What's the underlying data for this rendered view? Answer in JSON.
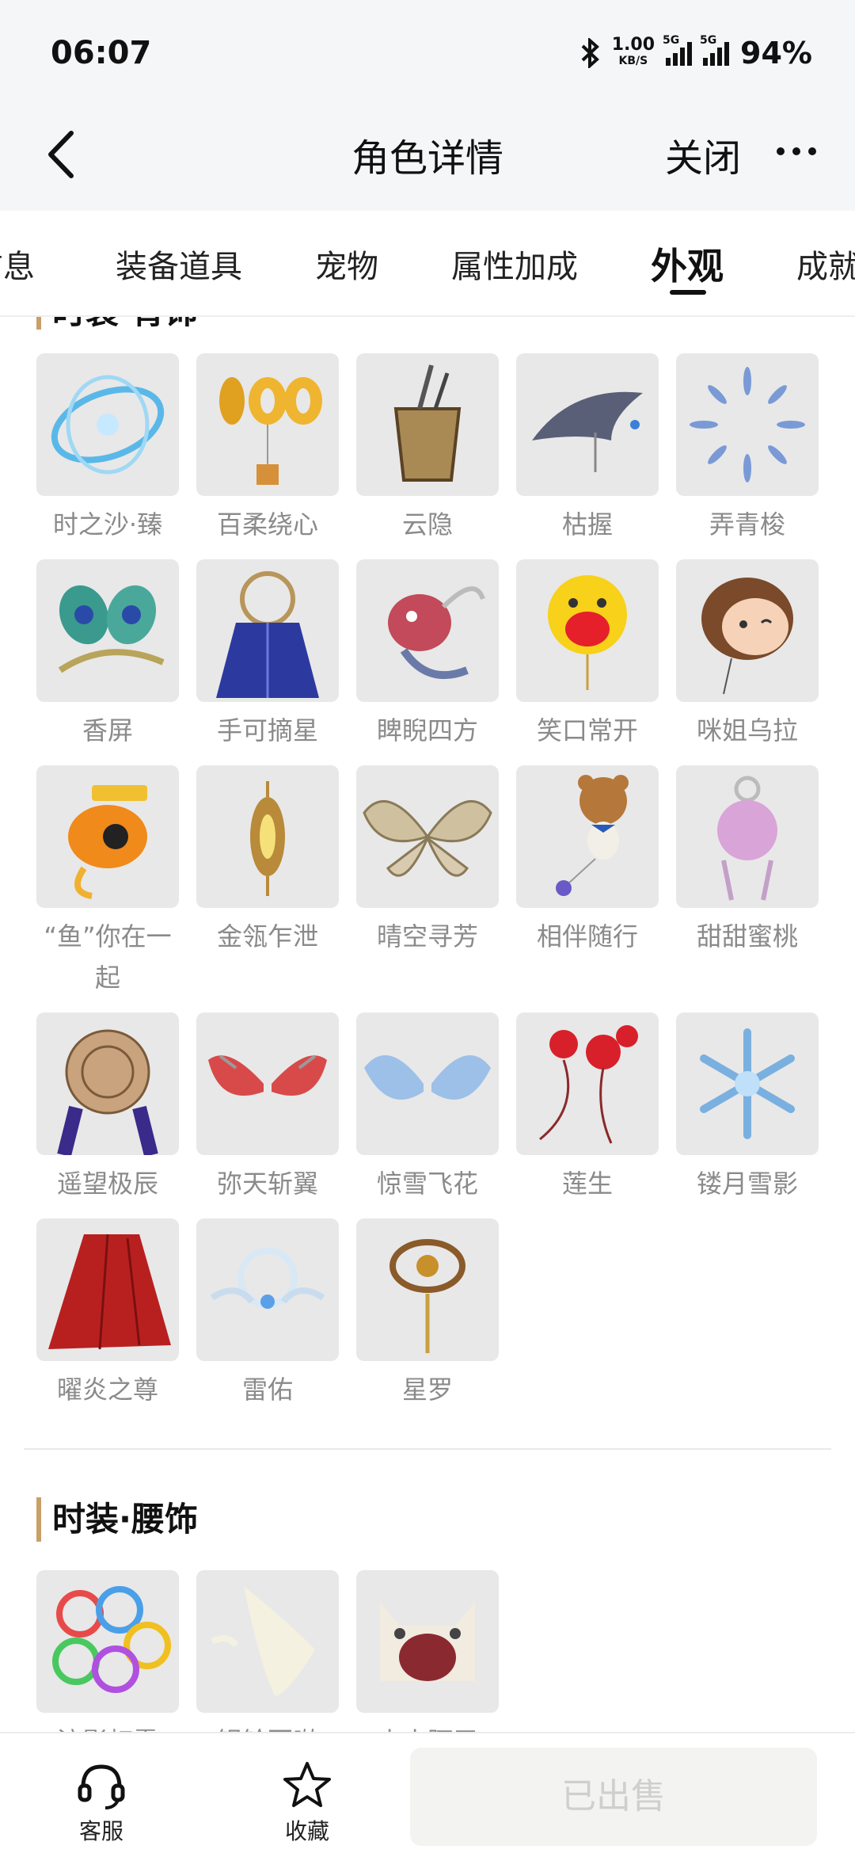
{
  "status": {
    "time": "06:07",
    "speed_value": "1.00",
    "speed_unit": "KB/S",
    "network": "5G",
    "battery": "94%"
  },
  "header": {
    "title": "角色详情",
    "close_label": "关闭"
  },
  "tabs": [
    {
      "label": "信息"
    },
    {
      "label": "装备道具"
    },
    {
      "label": "宠物"
    },
    {
      "label": "属性加成"
    },
    {
      "label": "外观"
    },
    {
      "label": "成就"
    }
  ],
  "section_back": {
    "title": "时装·背饰",
    "items": [
      {
        "name": "时之沙·臻",
        "icon": "hourglass-ring-icon"
      },
      {
        "name": "百柔绕心",
        "icon": "balloon-100-icon"
      },
      {
        "name": "云隐",
        "icon": "box-swords-icon"
      },
      {
        "name": "枯握",
        "icon": "dark-wing-icon"
      },
      {
        "name": "弄青梭",
        "icon": "blade-circle-icon"
      },
      {
        "name": "香屏",
        "icon": "peacock-feather-icon"
      },
      {
        "name": "手可摘星",
        "icon": "star-cape-icon"
      },
      {
        "name": "睥睨四方",
        "icon": "dragon-head-icon"
      },
      {
        "name": "笑口常开",
        "icon": "smile-balloon-icon"
      },
      {
        "name": "咪姐乌拉",
        "icon": "girl-balloon-icon"
      },
      {
        "name": "“鱼”你在一起",
        "icon": "fish-icon"
      },
      {
        "name": "金瓴乍泄",
        "icon": "golden-lantern-icon"
      },
      {
        "name": "晴空寻芳",
        "icon": "fairy-wings-icon"
      },
      {
        "name": "相伴随行",
        "icon": "bear-balloon-icon"
      },
      {
        "name": "甜甜蜜桃",
        "icon": "peach-charm-icon"
      },
      {
        "name": "遥望极辰",
        "icon": "compass-sphere-icon"
      },
      {
        "name": "弥天斩翼",
        "icon": "red-wings-icon"
      },
      {
        "name": "惊雪飞花",
        "icon": "ice-wings-icon"
      },
      {
        "name": "莲生",
        "icon": "lotus-flower-icon"
      },
      {
        "name": "镂月雪影",
        "icon": "snowflake-icon"
      },
      {
        "name": "曜炎之尊",
        "icon": "red-cloak-icon"
      },
      {
        "name": "雷佑",
        "icon": "halo-ring-icon"
      },
      {
        "name": "星罗",
        "icon": "astrolabe-icon"
      }
    ]
  },
  "section_waist": {
    "title": "时装·腰饰",
    "items": [
      {
        "name": "流影虹霓",
        "icon": "rainbow-rings-icon"
      },
      {
        "name": "银铃百啭",
        "icon": "white-bird-icon"
      },
      {
        "name": "小小阿甲",
        "icon": "cat-head-icon"
      }
    ]
  },
  "bottom": {
    "service_label": "客服",
    "favorite_label": "收藏",
    "sold_label": "已出售"
  }
}
